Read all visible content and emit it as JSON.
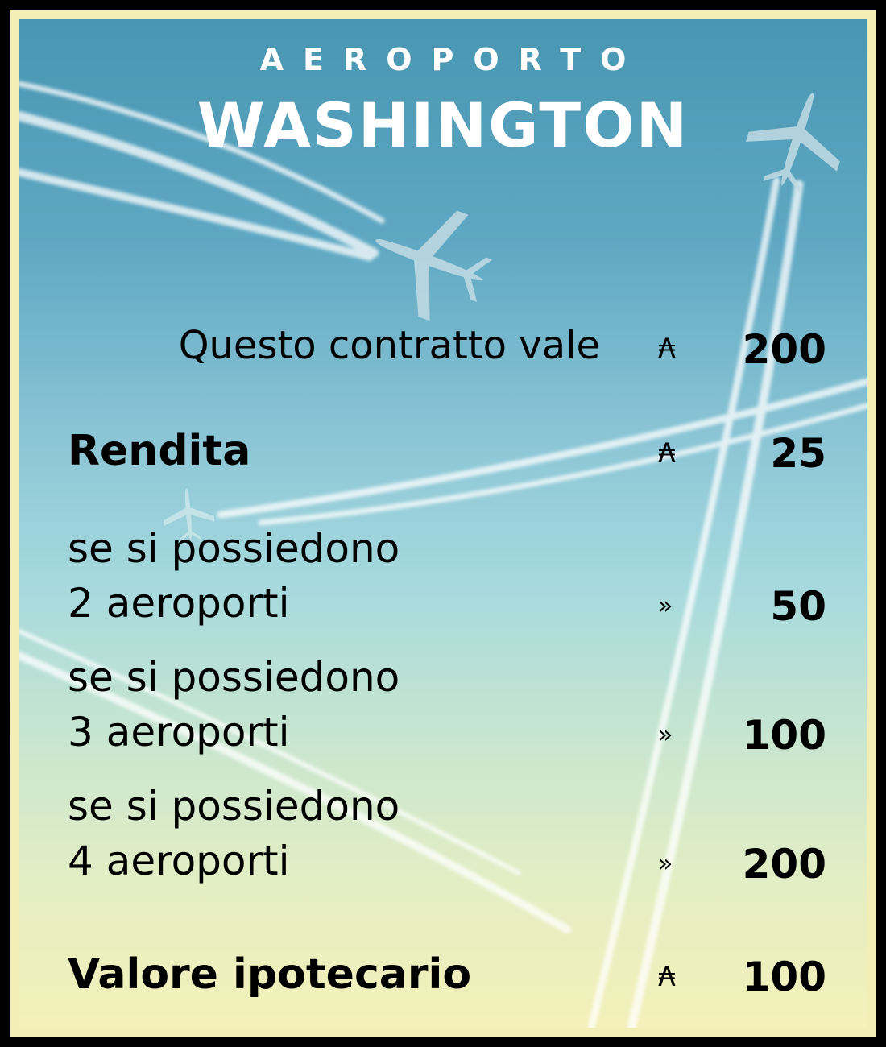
{
  "header": {
    "kicker": "AEROPORTO",
    "name": "WASHINGTON"
  },
  "contract": {
    "label": "Questo contratto vale",
    "symbol": "₳",
    "value": "200"
  },
  "rent": {
    "label": "Rendita",
    "symbol": "₳",
    "value": "25"
  },
  "tiers": [
    {
      "line1": "se si possiedono",
      "line2": "2 aeroporti",
      "symbol": "»",
      "value": "50"
    },
    {
      "line1": "se si possiedono",
      "line2": "3 aeroporti",
      "symbol": "»",
      "value": "100"
    },
    {
      "line1": "se si possiedono",
      "line2": "4 aeroporti",
      "symbol": "»",
      "value": "200"
    }
  ],
  "mortgage": {
    "label": "Valore ipotecario",
    "symbol": "₳",
    "value": "100"
  },
  "illustration": {
    "plane_icon": "airplane-icon",
    "contrail_color": "#ffffff",
    "sky_top_color": "#4896b2",
    "sky_bottom_color": "#f4f0b9",
    "border_color": "#f3eeb4"
  }
}
